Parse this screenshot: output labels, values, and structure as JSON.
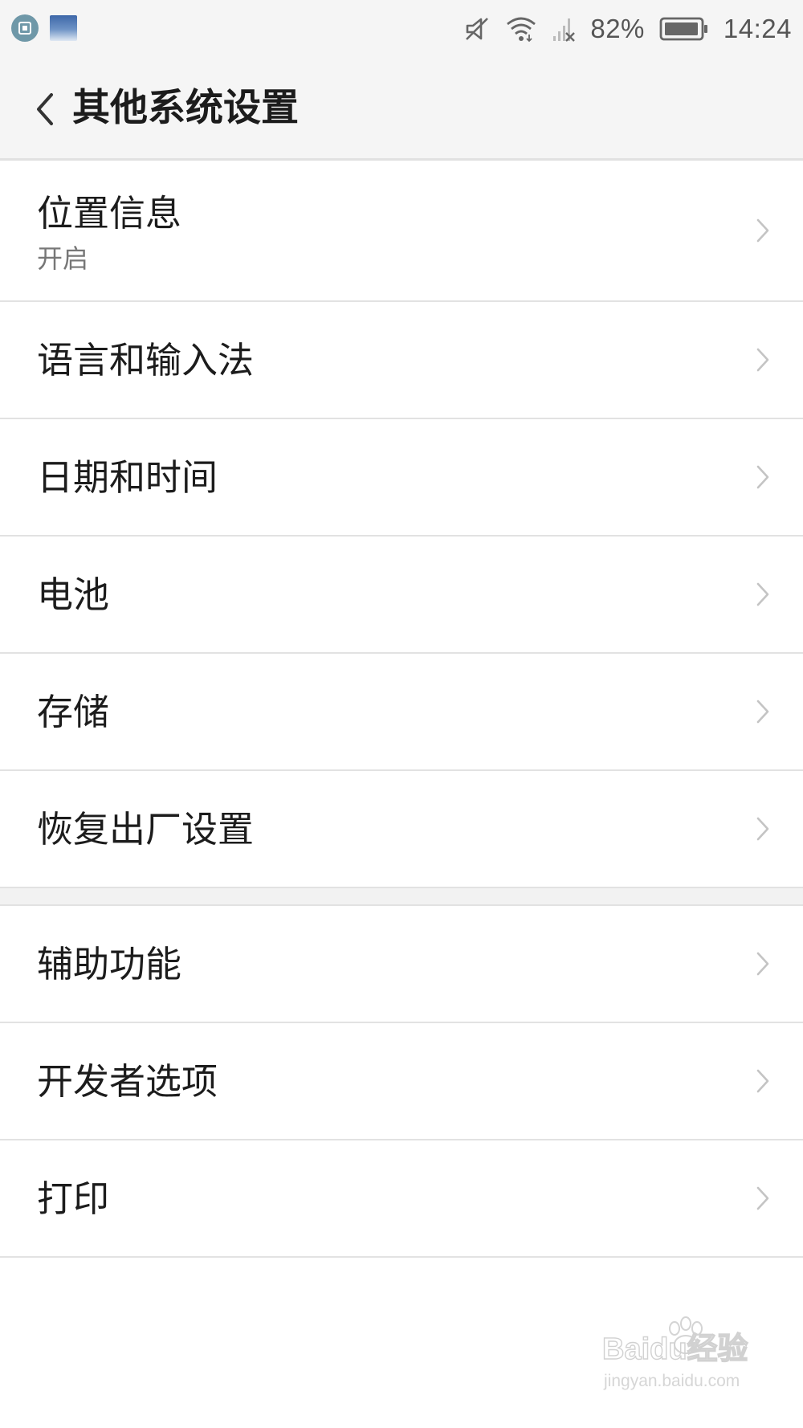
{
  "status_bar": {
    "battery_percent": "82%",
    "time": "14:24",
    "icons": [
      "gallery-app-icon",
      "photo-app-icon",
      "mute-icon",
      "wifi-icon",
      "no-signal-icon",
      "battery-icon"
    ]
  },
  "header": {
    "title": "其他系统设置"
  },
  "settings": {
    "items": [
      {
        "title": "位置信息",
        "subtitle": "开启"
      },
      {
        "title": "语言和输入法"
      },
      {
        "title": "日期和时间"
      },
      {
        "title": "电池"
      },
      {
        "title": "存储"
      },
      {
        "title": "恢复出厂设置"
      },
      {
        "title": "辅助功能"
      },
      {
        "title": "开发者选项"
      },
      {
        "title": "打印"
      }
    ]
  },
  "watermark": {
    "brand": "Baidu经验",
    "url": "jingyan.baidu.com"
  },
  "colors": {
    "background": "#ffffff",
    "header_bg": "#f5f5f5",
    "divider": "#e2e2e2",
    "text": "#1c1c1c",
    "secondary_text": "#777777"
  }
}
